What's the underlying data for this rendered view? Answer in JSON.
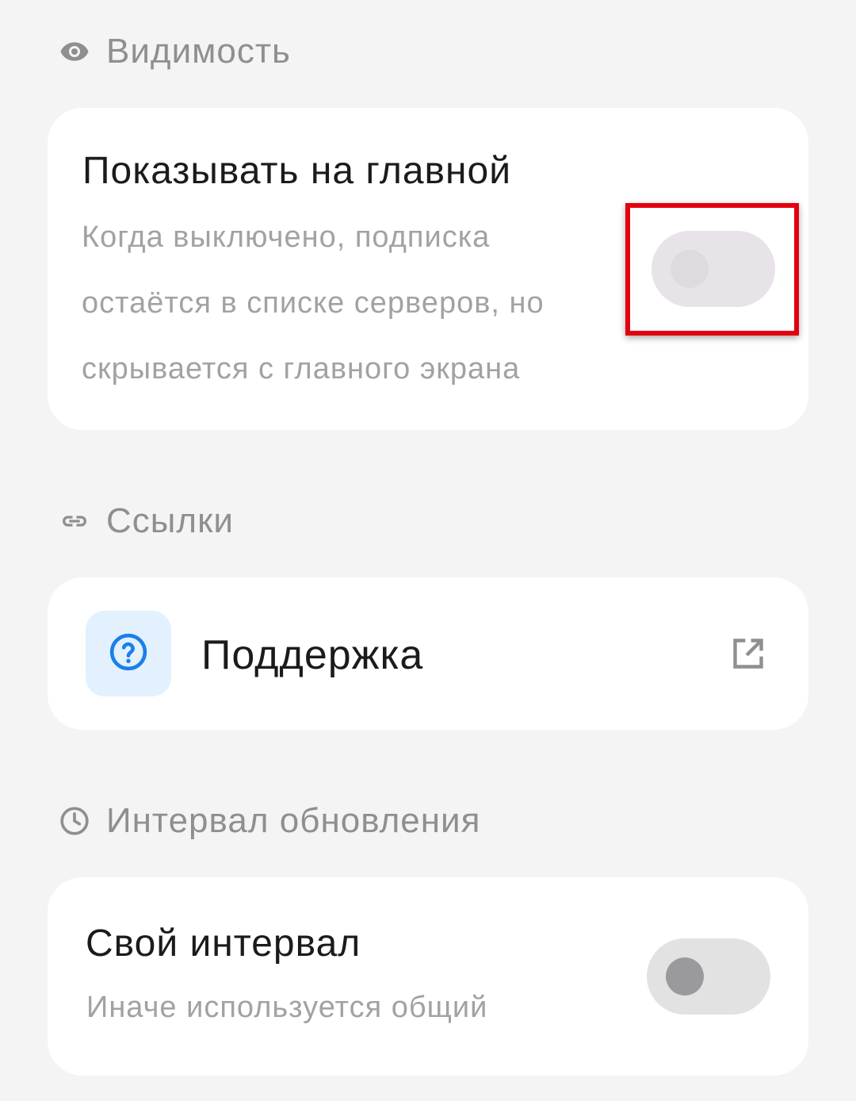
{
  "sections": {
    "visibility": {
      "header": "Видимость",
      "icon": "eye-icon",
      "row": {
        "title": "Показывать на главной",
        "description_lines": [
          "Когда выключено, подписка",
          "остаётся в списке серверов, но",
          "скрывается с главного экрана"
        ],
        "toggle_on": false
      }
    },
    "links": {
      "header": "Ссылки",
      "icon": "link-icon",
      "row": {
        "title": "Поддержка",
        "icon": "help-circle-icon",
        "trailing_icon": "open-external-icon"
      }
    },
    "interval": {
      "header": "Интервал обновления",
      "icon": "clock-icon",
      "row": {
        "title": "Свой интервал",
        "description": "Иначе используется общий",
        "toggle_on": false
      }
    }
  },
  "colors": {
    "background": "#f4f4f4",
    "card": "#ffffff",
    "section_header": "#8f8f8f",
    "title": "#1b1b1b",
    "description": "#a2a2a2",
    "accent_blue": "#1a7fe8",
    "accent_blue_bg": "#e3f0fe",
    "toggle_off_track_highlighted": "#e7e3e9",
    "toggle_off_track": "#e2e2e2",
    "toggle_off_thumb": "#9a9a9e",
    "highlight_border": "#e3000f"
  }
}
